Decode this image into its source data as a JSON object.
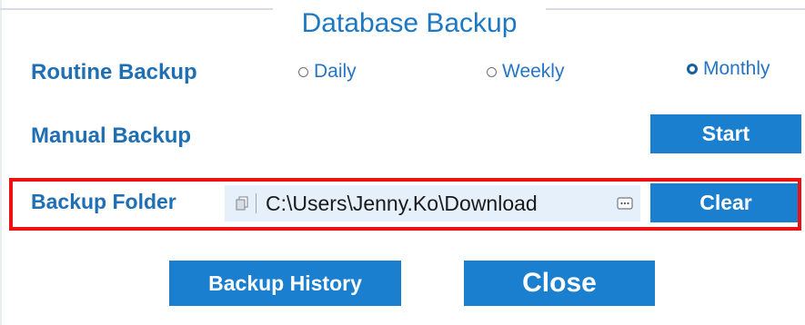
{
  "dialog": {
    "title": "Database Backup"
  },
  "routine_backup": {
    "label": "Routine Backup",
    "options": [
      {
        "label": "Daily",
        "selected": false
      },
      {
        "label": "Weekly",
        "selected": false
      },
      {
        "label": "Monthly",
        "selected": true
      }
    ]
  },
  "manual_backup": {
    "label": "Manual Backup",
    "start_label": "Start"
  },
  "backup_folder": {
    "label": "Backup Folder",
    "path": "C:\\Users\\Jenny.Ko\\Download",
    "clear_label": "Clear"
  },
  "footer": {
    "history_label": "Backup History",
    "close_label": "Close"
  },
  "colors": {
    "accent": "#1b7fcf",
    "label_text": "#1f6fb5",
    "highlight": "#ee1111"
  }
}
